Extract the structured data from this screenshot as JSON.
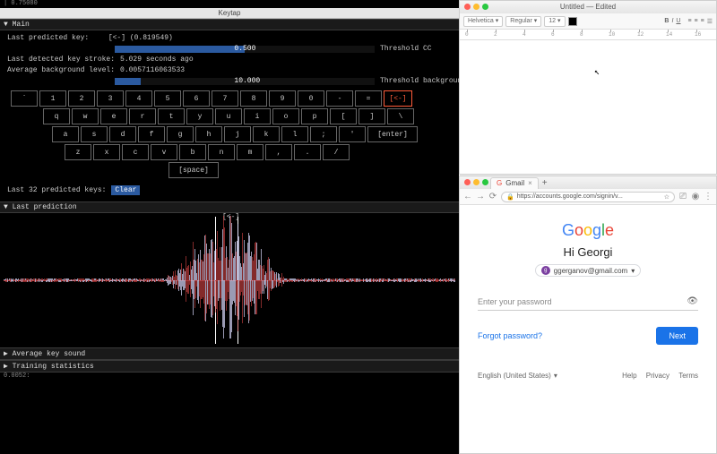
{
  "keytap": {
    "window_title": "Keytap",
    "corner_value": "| 0.75080",
    "sections": {
      "main": "▼ Main",
      "last_prediction": "▼ Last prediction",
      "avg_key_sound": "▶ Average key sound",
      "training_stats": "▶ Training statistics"
    },
    "info": {
      "last_predicted_label": "Last predicted key:",
      "last_predicted_value": "[<-] (0.819549)",
      "last_detected_label": "Last detected key stroke:",
      "last_detected_value": "5.029 seconds ago",
      "avg_bg_label": "Average background level:",
      "avg_bg_value": "0.0057116063533"
    },
    "thresholds": {
      "cc": {
        "value": "0.500",
        "fill_pct": 50,
        "label": "Threshold CC"
      },
      "bg": {
        "value": "10.000",
        "fill_pct": 10,
        "label": "Threshold background"
      }
    },
    "keyboard": {
      "row1": [
        "`",
        "1",
        "2",
        "3",
        "4",
        "5",
        "6",
        "7",
        "8",
        "9",
        "0",
        "-",
        "=",
        "[<-]"
      ],
      "row2": [
        "q",
        "w",
        "e",
        "r",
        "t",
        "y",
        "u",
        "i",
        "o",
        "p",
        "[",
        "]",
        "\\"
      ],
      "row3": [
        "a",
        "s",
        "d",
        "f",
        "g",
        "h",
        "j",
        "k",
        "l",
        ";",
        "'",
        "[enter]"
      ],
      "row4": [
        "z",
        "x",
        "c",
        "v",
        "b",
        "n",
        "m",
        ",",
        ".",
        "/"
      ],
      "space": "[space]",
      "highlighted": "[<-]"
    },
    "last32_label": "Last 32 predicted keys:",
    "clear_label": "Clear",
    "waveform_marker": "[<-]",
    "bottom_tiny": "0.0052:"
  },
  "textedit": {
    "title": "Untitled — Edited",
    "font_name": "Helvetica",
    "font_style": "Regular",
    "font_size": "12",
    "ruler_ticks": [
      "0",
      "2",
      "4",
      "6",
      "8",
      "10",
      "12",
      "14",
      "16"
    ]
  },
  "browser": {
    "tab_title": "Gmail",
    "url": "https://accounts.google.com/signin/v...",
    "logo_letters": [
      "G",
      "o",
      "o",
      "g",
      "l",
      "e"
    ],
    "greeting": "Hi Georgi",
    "account_email": "ggerganov@gmail.com",
    "password_placeholder": "Enter your password",
    "forgot_label": "Forgot password?",
    "next_label": "Next",
    "language": "English (United States)",
    "footer_links": [
      "Help",
      "Privacy",
      "Terms"
    ]
  }
}
